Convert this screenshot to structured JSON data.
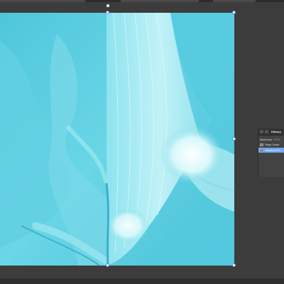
{
  "history_panel": {
    "title": "History",
    "brush_label": "Maximum",
    "items": [
      {
        "label": "Stage Grade",
        "active": false
      },
      {
        "label": "Transform/Fill",
        "active": true
      }
    ]
  },
  "colors": {
    "background": "#3b3b3b",
    "image_base": "#5fd0e0",
    "selection_accent": "#6fa6f0",
    "handle_border": "#5a8fd8"
  }
}
